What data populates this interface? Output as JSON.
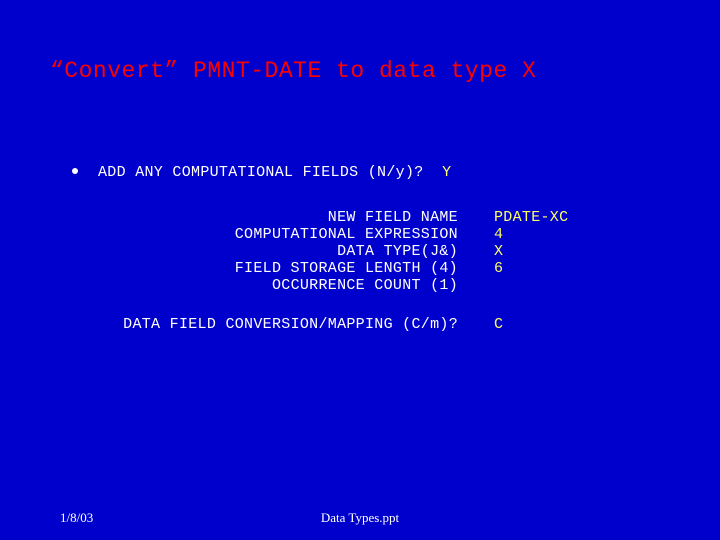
{
  "title": "“Convert” PMNT-DATE to data type X",
  "prompt": {
    "label": "ADD ANY COMPUTATIONAL FIELDS (N/y)?",
    "answer": "Y"
  },
  "fields": [
    {
      "label": "NEW FIELD NAME",
      "answer": "PDATE-XC"
    },
    {
      "label": "COMPUTATIONAL EXPRESSION",
      "answer": "4"
    },
    {
      "label": "DATA TYPE(J&)",
      "answer": "X"
    },
    {
      "label": "FIELD STORAGE LENGTH (4)",
      "answer": "6"
    },
    {
      "label": "OCCURRENCE COUNT (1)",
      "answer": ""
    }
  ],
  "conversion": {
    "label": "DATA FIELD CONVERSION/MAPPING (C/m)?",
    "answer": "C"
  },
  "footer": {
    "date": "1/8/03",
    "file": "Data Types.ppt"
  }
}
